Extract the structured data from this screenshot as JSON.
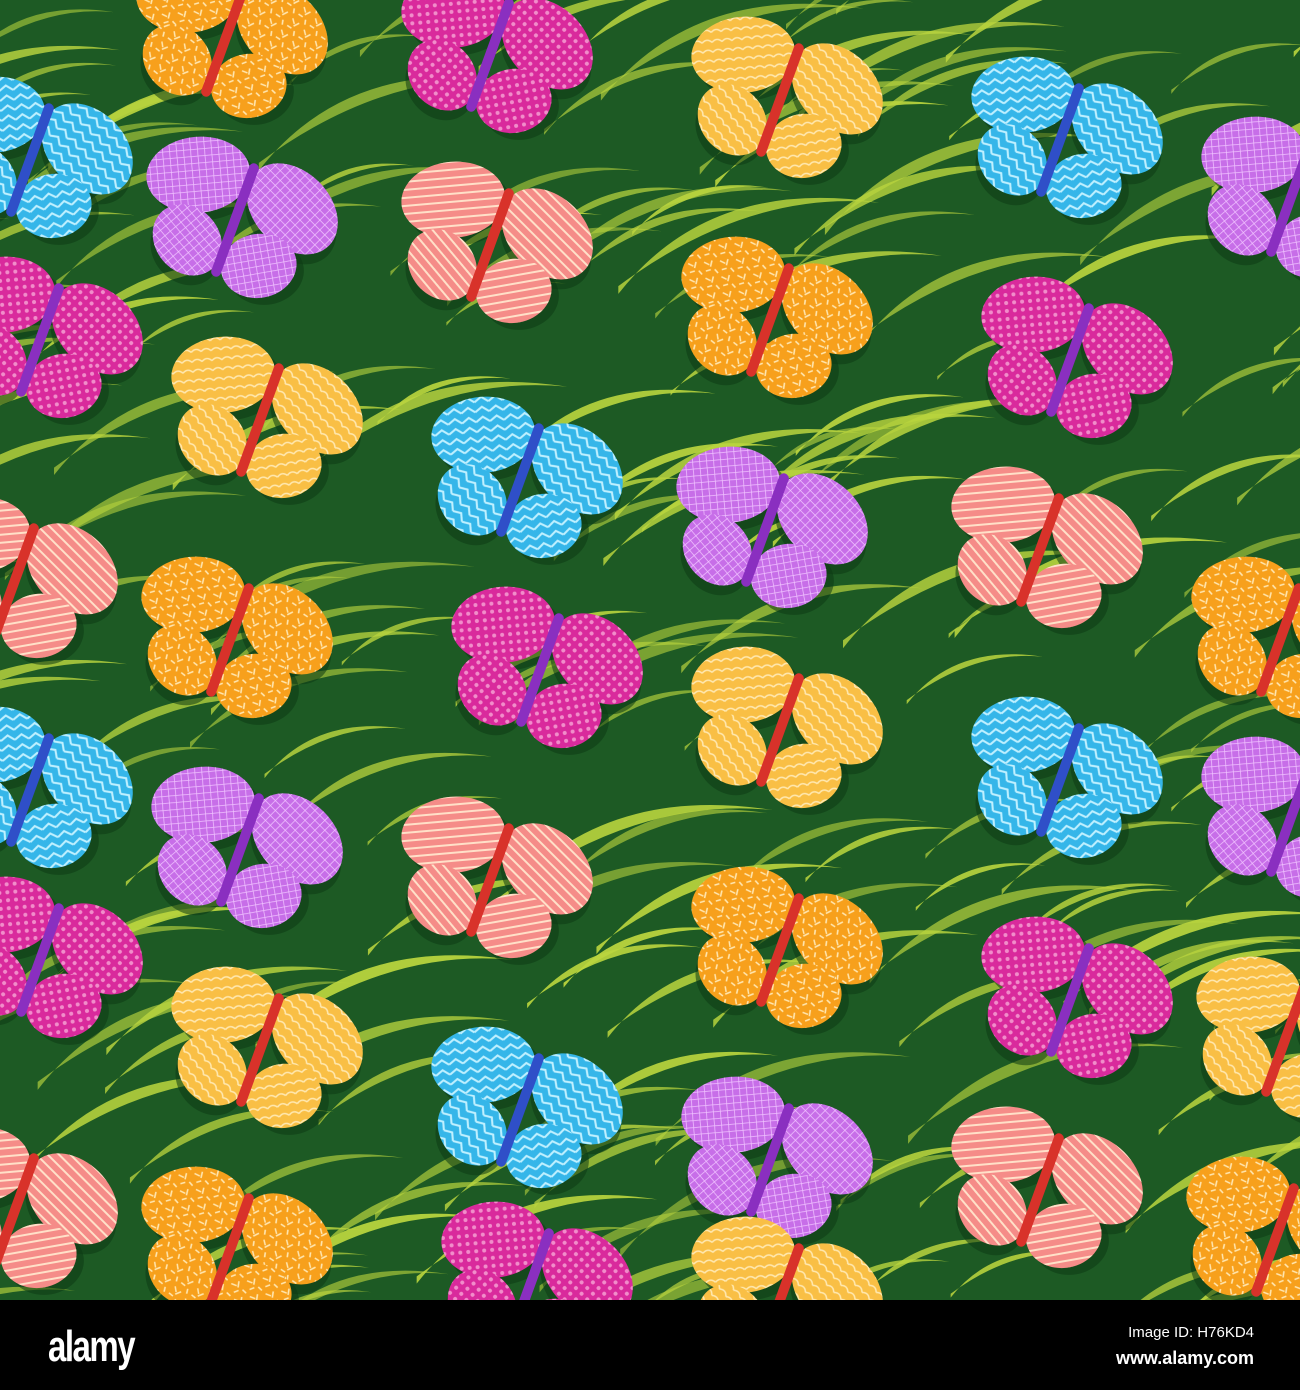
{
  "artwork": {
    "description_label": "",
    "background_color": "#1d5a24",
    "grass_color": "#b9d43e",
    "butterfly_colors": {
      "orange": "#f7a01c",
      "magenta": "#d92a9c",
      "yellow": "#f9bf45",
      "blue": "#35b6e9",
      "purple": "#c76ee8",
      "salmon": "#f58c88"
    }
  },
  "watermark": {
    "logo": "alamy",
    "image_id": "Image ID: H76KD4",
    "site": "www.alamy.com"
  }
}
